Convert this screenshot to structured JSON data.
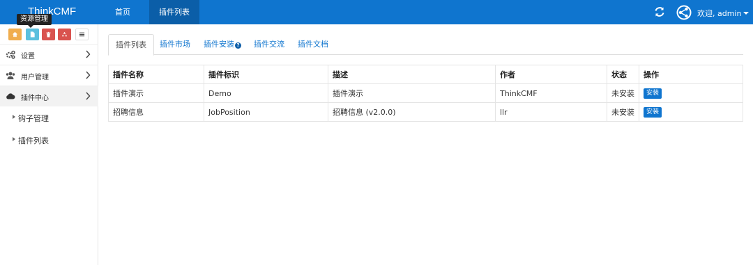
{
  "header": {
    "brand": "ThinkCMF",
    "nav": [
      {
        "label": "首页"
      },
      {
        "label": "插件列表"
      }
    ],
    "welcome": "欢迎, admin"
  },
  "tooltip": "资源管理",
  "sidebar": {
    "shortcuts": [
      {
        "icon": "home-icon",
        "color": "#f0ad4e"
      },
      {
        "icon": "file-icon",
        "color": "#5bc0de"
      },
      {
        "icon": "trash-icon",
        "color": "#d9534f"
      },
      {
        "icon": "recycle-icon",
        "color": "#d9534f"
      },
      {
        "icon": "list-icon",
        "color": "#ffffff"
      }
    ],
    "items": [
      {
        "label": "设置",
        "icon": "cogs-icon"
      },
      {
        "label": "用户管理",
        "icon": "users-icon"
      },
      {
        "label": "插件中心",
        "icon": "cloud-icon"
      }
    ],
    "sub_items": [
      {
        "label": "钩子管理"
      },
      {
        "label": "插件列表"
      }
    ]
  },
  "tabs": [
    {
      "label": "插件列表",
      "active": true
    },
    {
      "label": "插件市场"
    },
    {
      "label": "插件安装"
    },
    {
      "label": "插件交流"
    },
    {
      "label": "插件文档"
    }
  ],
  "table": {
    "headers": [
      "插件名称",
      "插件标识",
      "描述",
      "作者",
      "状态",
      "操作"
    ],
    "rows": [
      {
        "name": "插件演示",
        "id": "Demo",
        "desc": "插件演示",
        "author": "ThinkCMF",
        "status": "未安装",
        "action": "安装"
      },
      {
        "name": "招聘信息",
        "id": "JobPosition",
        "desc": "招聘信息 (v2.0.0)",
        "author": "llr",
        "status": "未安装",
        "action": "安装"
      }
    ]
  },
  "colors": {
    "primary": "#0f75cf",
    "nav_active": "#0b5ea8"
  }
}
